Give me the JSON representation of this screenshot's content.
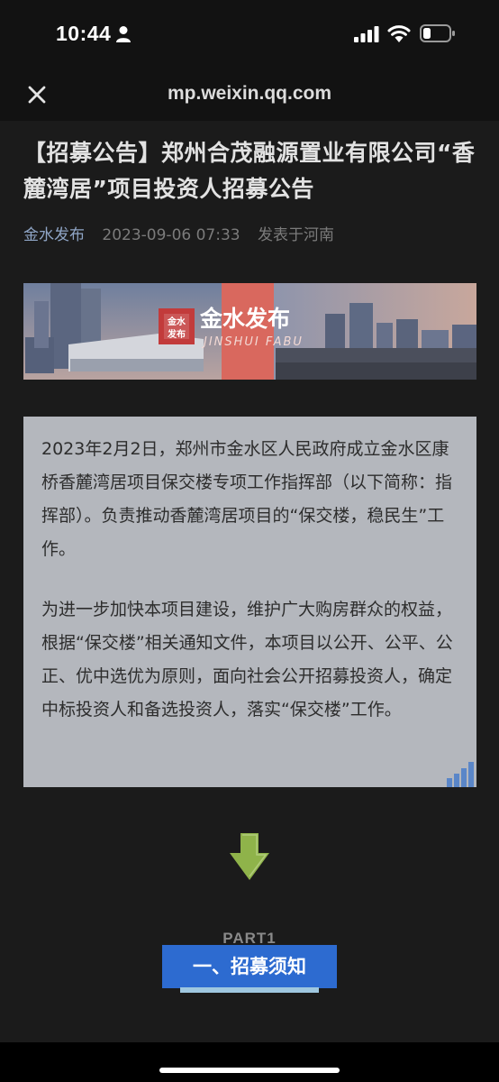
{
  "status_bar": {
    "time": "10:44",
    "icons": [
      "person-icon",
      "signal-icon",
      "wifi-icon",
      "battery-icon"
    ]
  },
  "nav": {
    "close_icon": "close-icon",
    "url": "mp.weixin.qq.com"
  },
  "article": {
    "title": "【招募公告】郑州合茂融源置业有限公司“香麓湾居”项目投资人招募公告",
    "author": "金水发布",
    "date": "2023-09-06 07:33",
    "location": "发表于河南",
    "banner": {
      "logo_text": "金水发布",
      "title": "金水发布",
      "subtitle": "JINSHUI FABU"
    },
    "paragraphs": [
      "2023年2月2日，郑州市金水区人民政府成立金水区康桥香麓湾居项目保交楼专项工作指挥部（以下简称：指挥部）。负责推动香麓湾居项目的“保交楼，稳民生”工作。",
      "为进一步加快本项目建设，维护广大购房群众的权益，根据“保交楼”相关通知文件，本项目以公开、公平、公正、优中选优为原则，面向社会公开招募投资人，确定中标投资人和备选投资人，落实“保交楼”工作。"
    ],
    "part_label": "PART1",
    "section_button": "一、招募须知"
  },
  "colors": {
    "link": "#8fa5c6",
    "section_button": "#2d6bd0",
    "card": "#b4b7bd",
    "arrow": "#8fb34a"
  }
}
